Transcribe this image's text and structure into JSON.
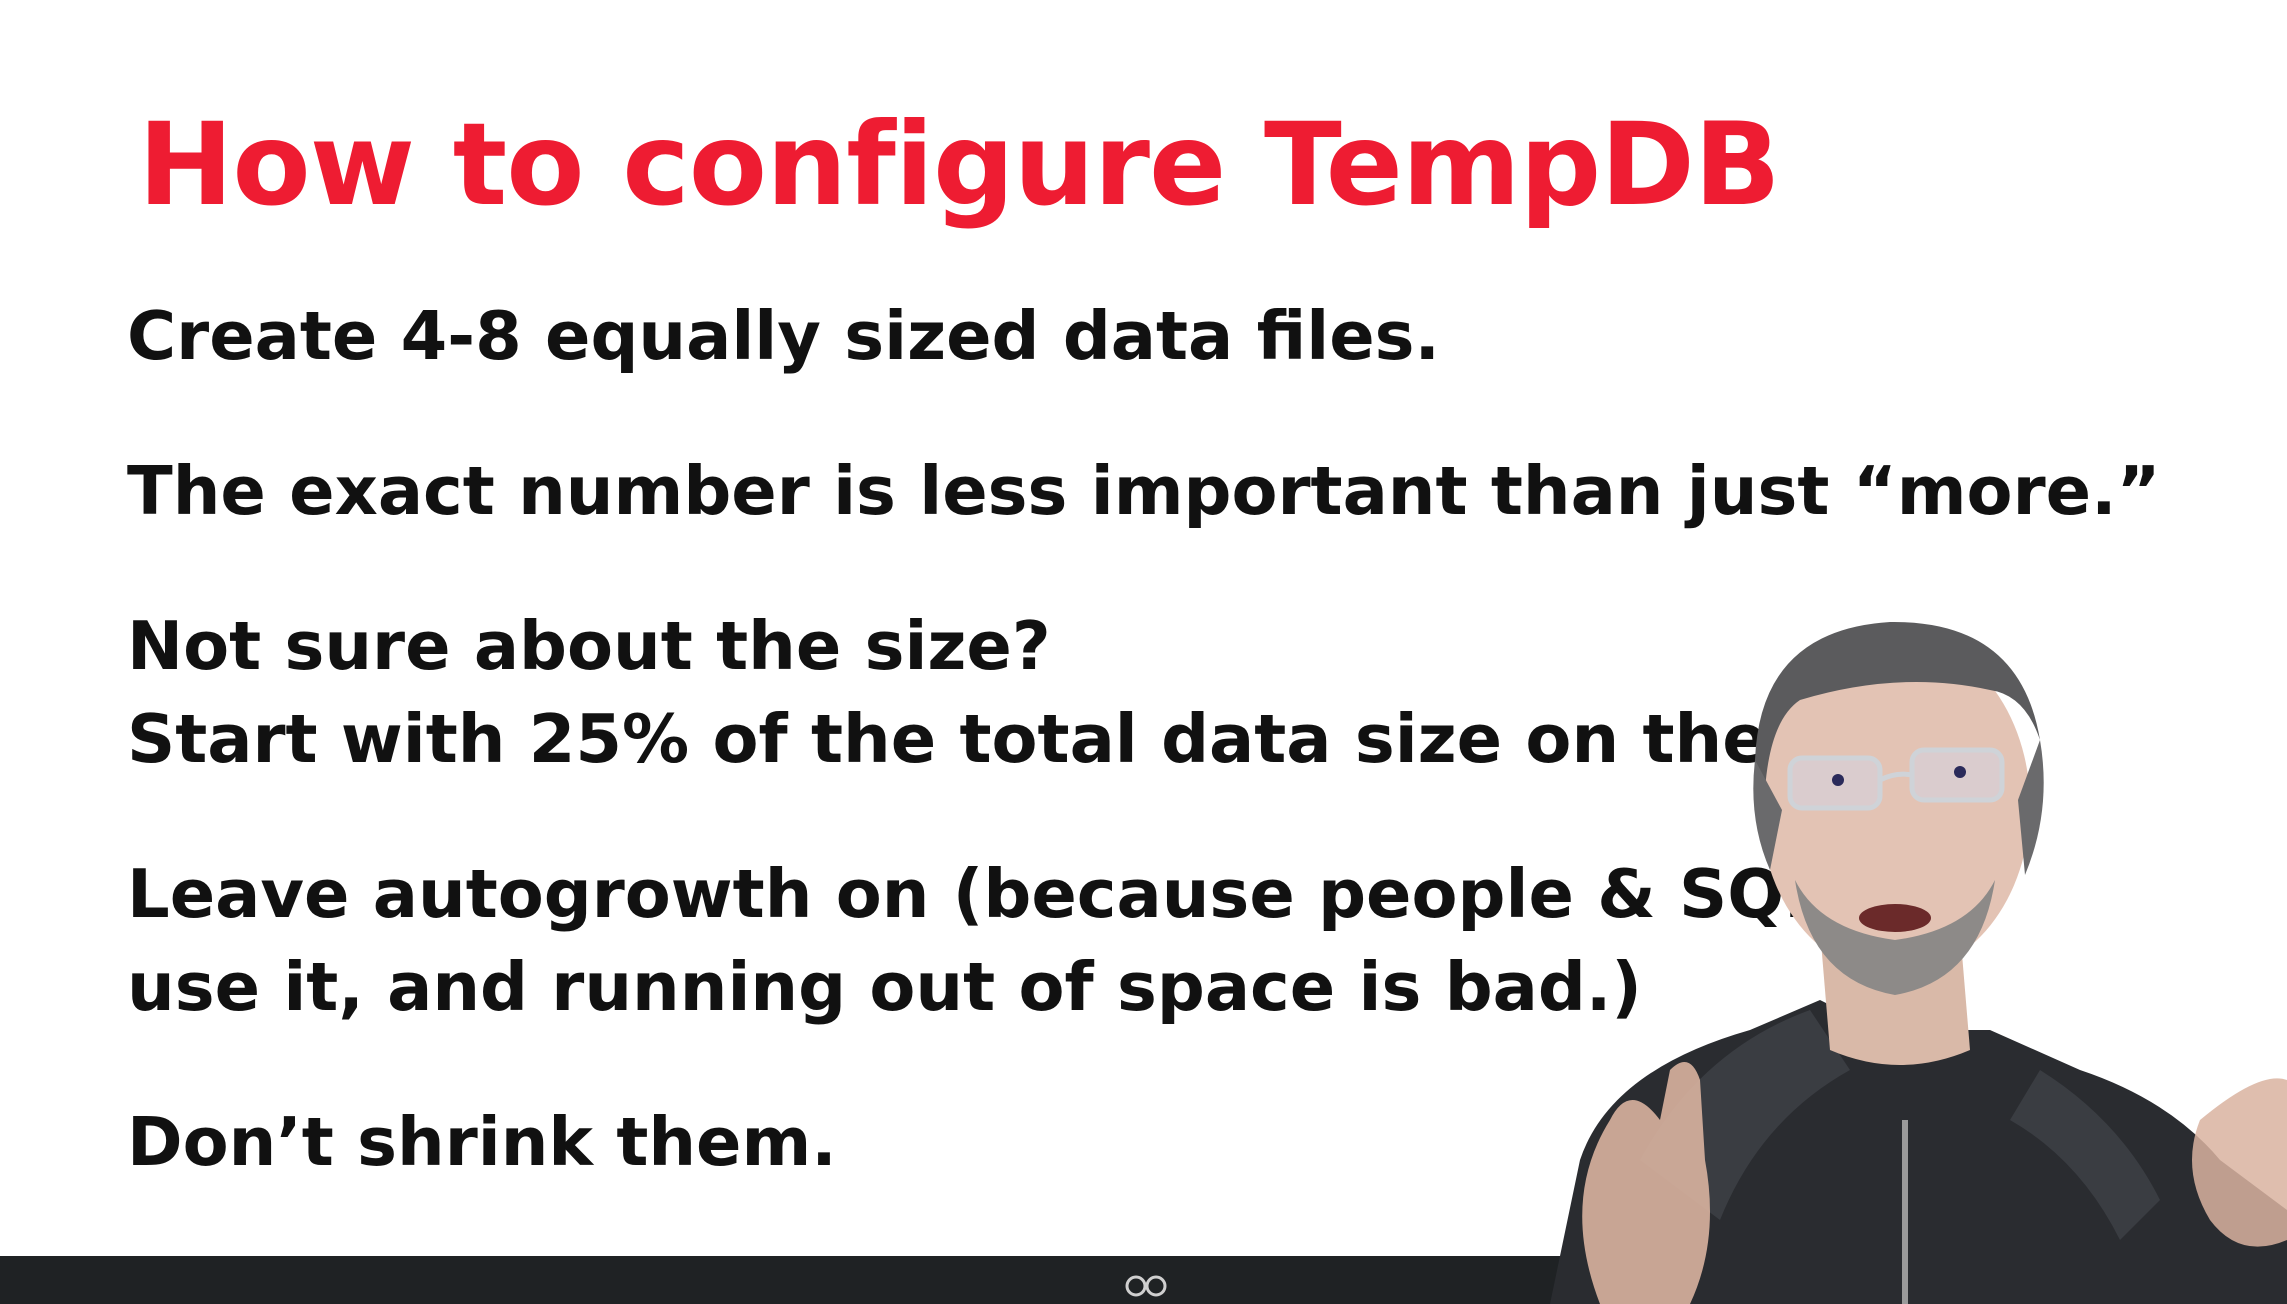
{
  "slide": {
    "title": "How to configure TempDB",
    "bullets": [
      {
        "lines": [
          "Create 4-8 equally sized data files."
        ]
      },
      {
        "lines": [
          "The exact number is less important than just “more.”"
        ]
      },
      {
        "lines": [
          "Not sure about the size?",
          "Start with 25% of the total data size on the s"
        ]
      },
      {
        "lines": [
          "Leave autogrowth on (because people & SQL",
          "use it, and running out of space is bad.)"
        ]
      },
      {
        "lines": [
          "Don’t shrink them."
        ]
      }
    ]
  },
  "colors": {
    "title": "#ee1c32",
    "text": "#111111",
    "background": "#ffffff",
    "bottom_bar": "#1f2224"
  },
  "icons": {
    "bottom_bar_icon": "glasses-icon"
  }
}
